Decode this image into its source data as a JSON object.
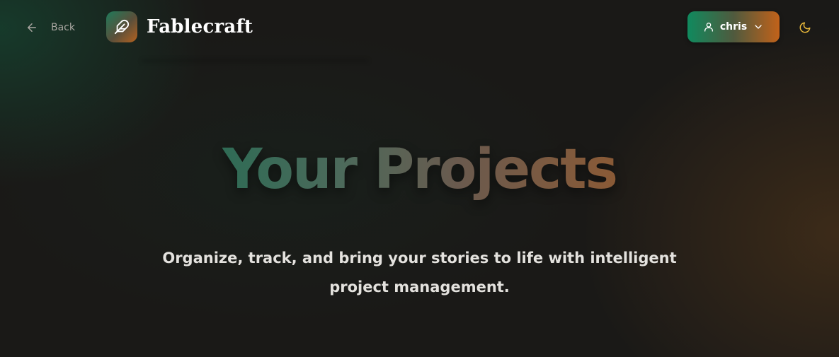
{
  "header": {
    "back_label": "Back",
    "brand_name": "Fablecraft",
    "user_name": "chris"
  },
  "hero": {
    "title": "Your Projects",
    "subtitle": "Organize, track, and bring your stories to life with intelligent project management."
  },
  "icons": {
    "back": "arrow-left-icon",
    "brand": "feather-icon",
    "user": "user-icon",
    "dropdown": "chevron-down-icon",
    "theme": "moon-icon"
  },
  "colors": {
    "accent_green": "#108a5e",
    "accent_orange": "#c2621a",
    "moon": "#e8b83a"
  }
}
